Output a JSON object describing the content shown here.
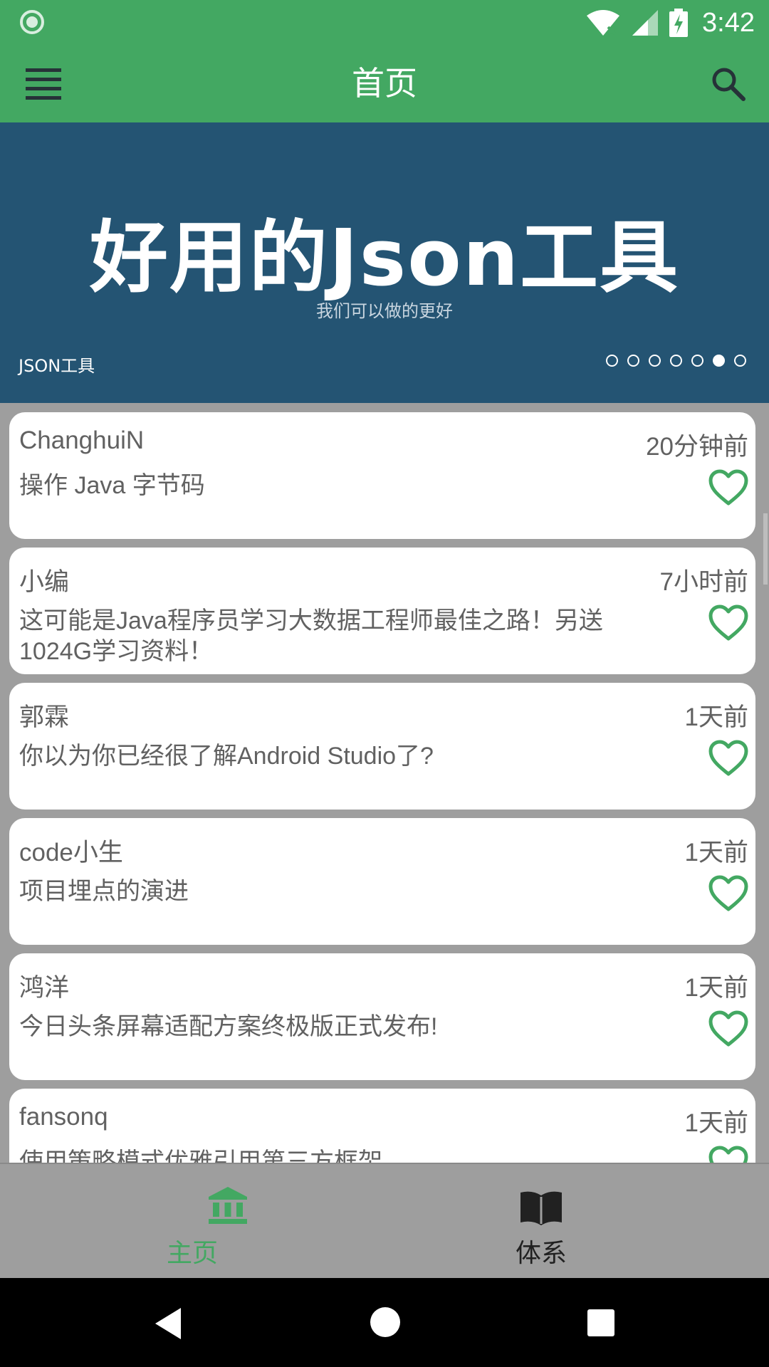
{
  "status_bar": {
    "time": "3:42"
  },
  "app_bar": {
    "title": "首页"
  },
  "banner": {
    "heading": "好用的Json工具",
    "subtitle": "我们可以做的更好",
    "caption": "JSON工具",
    "indicator": {
      "count": 7,
      "active_index": 5
    }
  },
  "articles": [
    {
      "author": "ChanghuiN",
      "time": "20分钟前",
      "title": "操作 Java 字节码"
    },
    {
      "author": "小编",
      "time": "7小时前",
      "title": "这可能是Java程序员学习大数据工程师最佳之路！另送1024G学习资料！"
    },
    {
      "author": "郭霖",
      "time": "1天前",
      "title": "你以为你已经很了解Android Studio了?"
    },
    {
      "author": "code小生",
      "time": "1天前",
      "title": "项目埋点的演进"
    },
    {
      "author": "鸿洋",
      "time": "1天前",
      "title": "今日头条屏幕适配方案终极版正式发布!"
    },
    {
      "author": " fansonq",
      "time": "1天前",
      "title": "使用策略模式优雅引用第三方框架"
    }
  ],
  "bottom_nav": [
    {
      "label": "主页",
      "icon": "bank-icon",
      "active": true
    },
    {
      "label": "体系",
      "icon": "book-icon",
      "active": false
    }
  ],
  "colors": {
    "primary": "#43a862",
    "banner_bg": "#245473",
    "heart": "#43a862",
    "inactive_nav": "#212121"
  }
}
